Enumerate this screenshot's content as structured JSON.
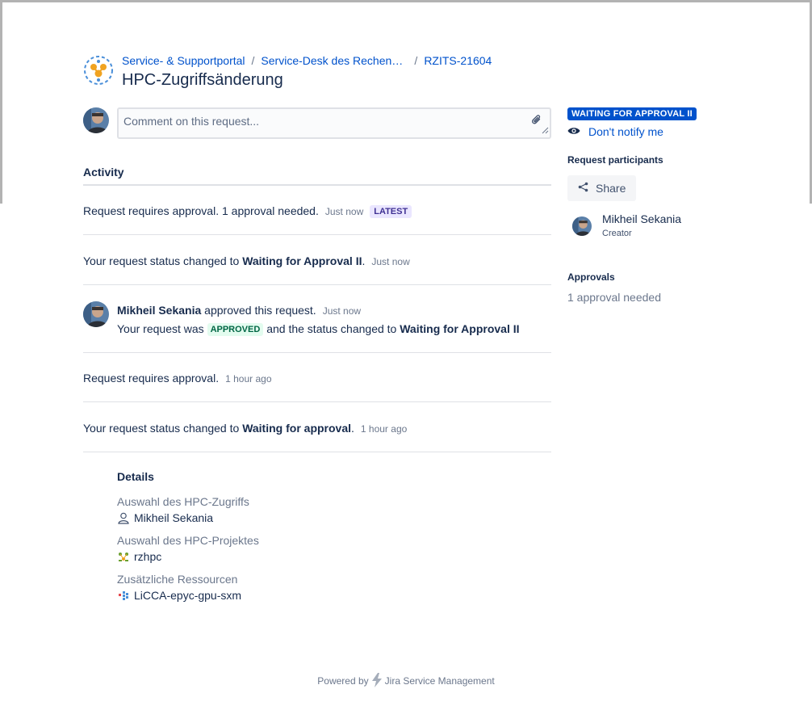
{
  "breadcrumb": {
    "portal": "Service- & Supportportal",
    "desk": "Service-Desk des Rechenz…",
    "issue_key": "RZITS-21604"
  },
  "page_title": "HPC-Zugriffsänderung",
  "comment": {
    "placeholder": "Comment on this request..."
  },
  "activity": {
    "heading": "Activity",
    "items": [
      {
        "text": "Request requires approval. 1 approval needed.",
        "time": "Just now",
        "badge": "LATEST"
      },
      {
        "prefix": "Your request status changed to ",
        "bold": "Waiting for Approval II",
        "suffix": ".",
        "time": "Just now"
      },
      {
        "user": "Mikheil Sekania",
        "action": " approved this request.",
        "time": "Just now",
        "line2_prefix": "Your request was ",
        "badge": "APPROVED",
        "line2_mid": " and the status changed to ",
        "line2_bold": "Waiting for Approval II"
      },
      {
        "text": "Request requires approval.",
        "time": "1 hour ago"
      },
      {
        "prefix": "Your request status changed to ",
        "bold": "Waiting for approval",
        "suffix": ".",
        "time": "1 hour ago"
      }
    ]
  },
  "details": {
    "title": "Details",
    "fields": [
      {
        "label": "Auswahl des HPC-Zugriffs",
        "value": "Mikheil Sekania",
        "icon": "user-icon"
      },
      {
        "label": "Auswahl des HPC-Projektes",
        "value": "rzhpc",
        "icon": "project-icon"
      },
      {
        "label": "Zusätzliche Ressourcen",
        "value": "LiCCA-epyc-gpu-sxm",
        "icon": "resource-icon"
      }
    ]
  },
  "sidebar": {
    "status": "WAITING FOR APPROVAL II",
    "notify_label": "Don't notify me",
    "participants_heading": "Request participants",
    "share_label": "Share",
    "participant": {
      "name": "Mikheil Sekania",
      "role": "Creator"
    },
    "approvals_heading": "Approvals",
    "approvals_needed": "1 approval needed"
  },
  "footer": {
    "powered_by": "Powered by",
    "product": "Jira Service Management"
  },
  "colors": {
    "link": "#0052cc",
    "status_badge": "#0052cc",
    "latest_bg": "#eae6ff",
    "approved_bg": "#e3fcef",
    "text": "#172b4d"
  }
}
